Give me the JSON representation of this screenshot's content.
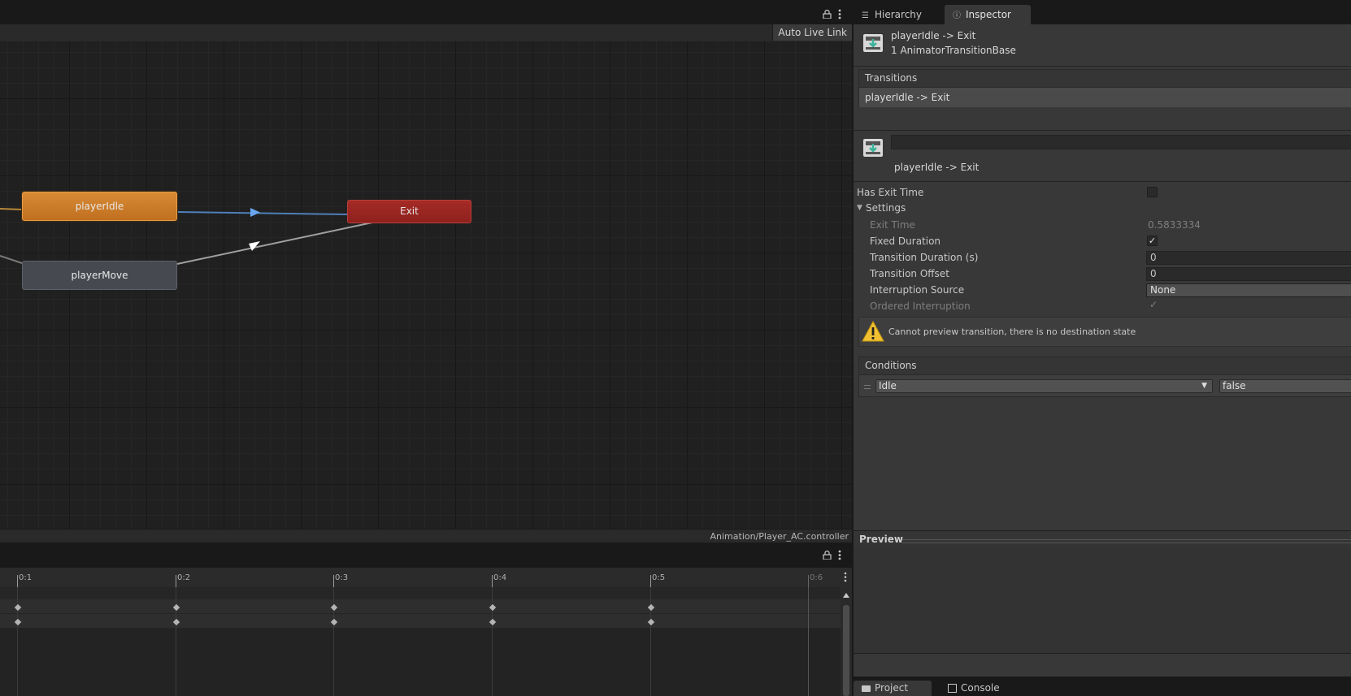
{
  "animator": {
    "auto_live_link": "Auto Live Link",
    "states": {
      "idle": "playerIdle",
      "move": "playerMove",
      "exit": "Exit"
    },
    "path": "Animation/Player_AC.controller"
  },
  "timeline": {
    "ticks": [
      "0:1",
      "0:2",
      "0:3",
      "0:4",
      "0:5",
      "0:6"
    ]
  },
  "tabs": {
    "hierarchy": "Hierarchy",
    "inspector": "Inspector"
  },
  "inspector": {
    "header_title": "playerIdle -> Exit",
    "header_subtitle": "1 AnimatorTransitionBase",
    "transitions_header": "Transitions",
    "transition_item": "playerIdle -> Exit",
    "transition_name_field": "",
    "transition_name_label": "playerIdle -> Exit",
    "has_exit_time": {
      "label": "Has Exit Time",
      "checked": false
    },
    "settings_label": "Settings",
    "settings": {
      "exit_time": {
        "label": "Exit Time",
        "value": "0.5833334"
      },
      "fixed_duration": {
        "label": "Fixed Duration",
        "checked": true
      },
      "transition_duration": {
        "label": "Transition Duration (s)",
        "value": "0"
      },
      "transition_offset": {
        "label": "Transition Offset",
        "value": "0"
      },
      "interruption_source": {
        "label": "Interruption Source",
        "value": "None"
      },
      "ordered_interruption": {
        "label": "Ordered Interruption",
        "checked": true
      }
    },
    "warning": "Cannot preview transition, there is no destination state",
    "conditions_header": "Conditions",
    "condition": {
      "parameter": "Idle",
      "value": "false"
    },
    "preview_label": "Preview"
  },
  "bottom_tabs": {
    "project": "Project",
    "console": "Console"
  },
  "colors": {
    "idle_state": "#c97b2a",
    "exit_state": "#9b2722",
    "transition_selected": "#4a90e2"
  }
}
